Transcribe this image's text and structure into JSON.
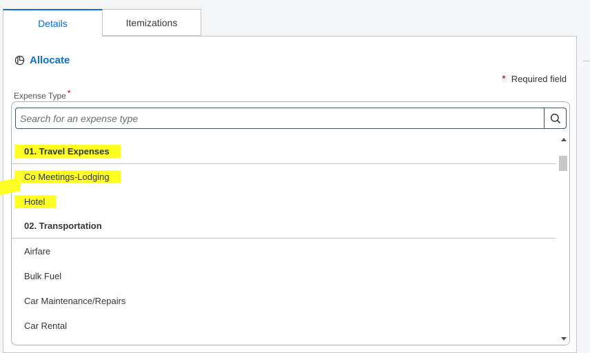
{
  "tabs": [
    {
      "label": "Details",
      "active": true
    },
    {
      "label": "Itemizations",
      "active": false
    }
  ],
  "allocate": {
    "label": "Allocate",
    "icon": "pie-chart-icon"
  },
  "required_field": {
    "star": "*",
    "label": "Required field"
  },
  "expense_type": {
    "label": "Expense Type",
    "star": "*",
    "search_placeholder": "Search for an expense type",
    "search_value": "",
    "items": [
      {
        "label": "01. Travel Expenses",
        "type": "group",
        "highlight": true
      },
      {
        "label": "Co Meetings-Lodging",
        "type": "option",
        "highlight": true
      },
      {
        "label": "Hotel",
        "type": "option",
        "highlight": true
      },
      {
        "label": "02. Transportation",
        "type": "group",
        "highlight": false
      },
      {
        "label": "Airfare",
        "type": "option",
        "highlight": false
      },
      {
        "label": "Bulk Fuel",
        "type": "option",
        "highlight": false
      },
      {
        "label": "Car Maintenance/Repairs",
        "type": "option",
        "highlight": false
      },
      {
        "label": "Car Rental",
        "type": "option",
        "highlight": false
      }
    ]
  },
  "colors": {
    "accent": "#0a6ed1",
    "required": "#bb0000",
    "highlight": "#ffff22"
  }
}
